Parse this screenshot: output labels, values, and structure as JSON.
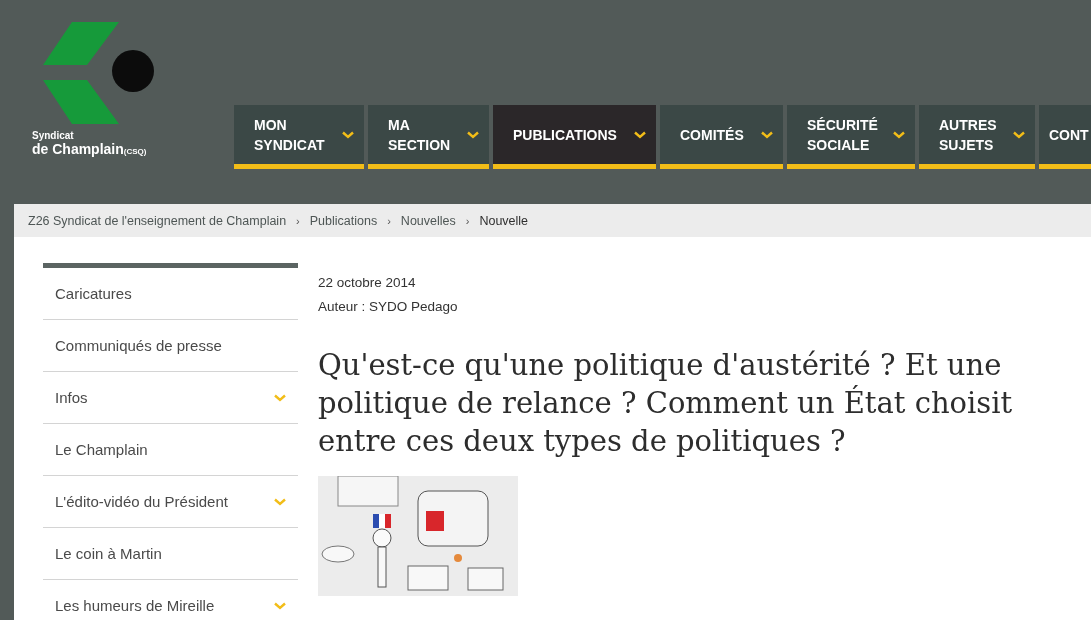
{
  "logo": {
    "line1": "Syndicat",
    "line2": "de Champlain",
    "suffix": "(CSQ)"
  },
  "nav": [
    {
      "label": "MON SYNDICAT",
      "selected": false,
      "kind": "menu"
    },
    {
      "label": "MA SECTION",
      "selected": false,
      "kind": "menu"
    },
    {
      "label": "PUBLICATIONS",
      "selected": true,
      "kind": "menu"
    },
    {
      "label": "COMITÉS",
      "selected": false,
      "kind": "menu"
    },
    {
      "label": "SÉCURITÉ SOCIALE",
      "selected": false,
      "kind": "menu"
    },
    {
      "label": "AUTRES SUJETS",
      "selected": false,
      "kind": "menu"
    },
    {
      "label": "CONT",
      "selected": false,
      "kind": "cut"
    }
  ],
  "breadcrumb_separator": "›",
  "breadcrumb": [
    "Z26 Syndicat de l'enseignement de Champlain",
    "Publications",
    "Nouvelles",
    "Nouvelle"
  ],
  "sidebar": {
    "items": [
      {
        "label": "Caricatures",
        "kind": "link"
      },
      {
        "label": "Communiqués de presse",
        "kind": "link"
      },
      {
        "label": "Infos",
        "kind": "expandable"
      },
      {
        "label": "Le Champlain",
        "kind": "link"
      },
      {
        "label": "L'édito-vidéo du Président",
        "kind": "expandable"
      },
      {
        "label": "Le coin à Martin",
        "kind": "link"
      },
      {
        "label": "Les humeurs de Mireille",
        "kind": "expandable"
      }
    ]
  },
  "article": {
    "date": "22 octobre 2014",
    "author": "Auteur : SYDO Pedago",
    "title": "Qu'est-ce qu'une politique d'austérité ? Et une politique de relance ? Comment un État choisit entre ces deux types de politiques ?"
  }
}
